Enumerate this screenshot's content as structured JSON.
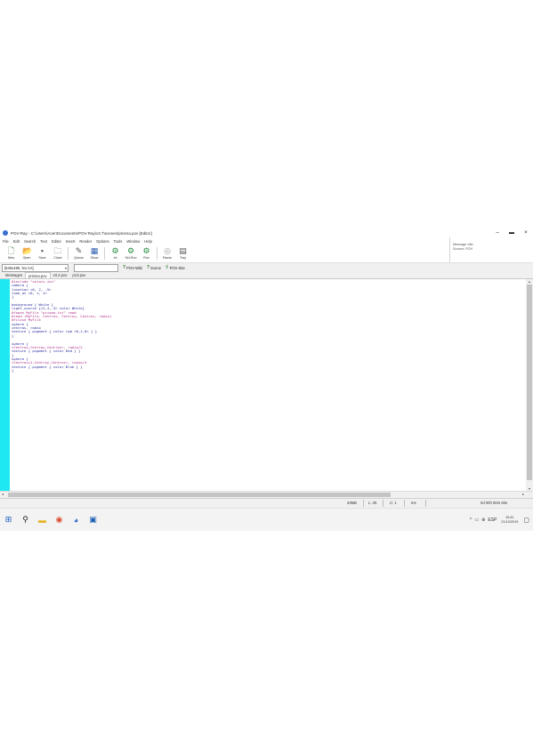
{
  "window": {
    "title": "POV-Ray - C:\\Users\\Acer\\Documents\\POV-Ray\\v3.7\\scenes\\prisma.pov [Editor]",
    "minimize": "–",
    "maximize": "▬",
    "close": "×"
  },
  "menu": [
    "File",
    "Edit",
    "Search",
    "Text",
    "Editor",
    "Insert",
    "Render",
    "Options",
    "Tools",
    "Window",
    "Help"
  ],
  "toolbar": [
    {
      "label": "New",
      "icon": "new-file-icon",
      "glyph": "🗋"
    },
    {
      "label": "Open",
      "icon": "open-folder-icon",
      "glyph": "📂"
    },
    {
      "label": "Save",
      "icon": "save-icon",
      "glyph": "▪"
    },
    {
      "label": "Close",
      "icon": "close-file-icon",
      "glyph": "🗀"
    },
    {
      "label": "Queue",
      "icon": "queue-icon",
      "glyph": "✎"
    },
    {
      "label": "Show",
      "icon": "show-icon",
      "glyph": "▦"
    },
    {
      "label": "Ini",
      "icon": "ini-icon",
      "glyph": "⚙"
    },
    {
      "label": "Sel-Run",
      "icon": "sel-run-icon",
      "glyph": "⚙"
    },
    {
      "label": "Run",
      "icon": "run-icon",
      "glyph": "⚙"
    },
    {
      "label": "Pause",
      "icon": "pause-icon",
      "glyph": "◎"
    },
    {
      "label": "Tray",
      "icon": "tray-icon",
      "glyph": "▤"
    }
  ],
  "message_panel": {
    "line1": "Message Idle",
    "line2": "Source: POV"
  },
  "resolution": {
    "value": "[640x480, No AA]",
    "arrow": "▾"
  },
  "links": [
    {
      "label": "POV-Wiki",
      "icon": "help-icon",
      "glyph": "?"
    },
    {
      "label": "Scene",
      "icon": "help-icon",
      "glyph": "?"
    },
    {
      "label": "POV-Site",
      "icon": "globe-icon",
      "glyph": "⚲"
    }
  ],
  "tabs": [
    {
      "label": "Messages",
      "active": false
    },
    {
      "label": "prisma.pov",
      "active": true
    },
    {
      "label": "v3.2.pov",
      "active": false
    },
    {
      "label": "p13.pov",
      "active": false
    }
  ],
  "code": [
    {
      "text": "#include \"colors.inc\"",
      "color": "#b0308a"
    },
    {
      "text": "camera {",
      "color": "#2a2aa0"
    },
    {
      "text": "location <0, 2, -5>",
      "color": "#2a2aa0"
    },
    {
      "text": "look_at <0, 1, 2>",
      "color": "#2a2aa0"
    },
    {
      "text": "}",
      "color": "#2a2aa0"
    },
    {
      "text": "",
      "color": "#2a2aa0"
    },
    {
      "text": "background { White }",
      "color": "#2a2aa0"
    },
    {
      "text": "light_source {<2,4,-3> color White}",
      "color": "#2a2aa0"
    },
    {
      "text": "#fopen MyFile \"prisma.txt\" read",
      "color": "#b0308a"
    },
    {
      "text": "#read (MyFile, Centrox, Centroy, Centroz, radio)",
      "color": "#b0308a"
    },
    {
      "text": "#fclose MyFile",
      "color": "#b0308a"
    },
    {
      "text": "sphere {",
      "color": "#2a2aa0"
    },
    {
      "text": "centros, radio",
      "color": "#2a2aa0"
    },
    {
      "text": "texture { pigment { color rgb <0,1,0> } }",
      "color": "#2a2aa0"
    },
    {
      "text": "}",
      "color": "#2a2aa0"
    },
    {
      "text": "",
      "color": "#2a2aa0"
    },
    {
      "text": "sphere {",
      "color": "#2a2aa0"
    },
    {
      "text": "<Centrox,Centroy,Centroz>, radio/2",
      "color": "#b0308a"
    },
    {
      "text": "texture { pigment { color Red } }",
      "color": "#2a2aa0"
    },
    {
      "text": "}",
      "color": "#2a2aa0"
    },
    {
      "text": "sphere {",
      "color": "#2a2aa0"
    },
    {
      "text": "<Centrox+2,Centroy,Centroz>, radio/4",
      "color": "#b0308a"
    },
    {
      "text": "texture { pigment { color Blue } }",
      "color": "#2a2aa0"
    },
    {
      "text": "}",
      "color": "#2a2aa0"
    }
  ],
  "status": {
    "mem": "33MB",
    "ins": "Ins",
    "line": "L: 25",
    "col": "C: 1",
    "time": "0d 00h 00m 00s"
  },
  "taskbar": {
    "icons": [
      {
        "name": "start-icon",
        "glyph": "⊞",
        "color": "#1b5fbf"
      },
      {
        "name": "search-icon",
        "glyph": "⚲",
        "color": "#222222"
      },
      {
        "name": "file-explorer-icon",
        "glyph": "▬",
        "color": "#e6b52a"
      },
      {
        "name": "chrome-icon",
        "glyph": "◉",
        "color": "#d94a2e"
      },
      {
        "name": "povray-icon",
        "glyph": "◕",
        "color": "#2a62c8"
      },
      {
        "name": "word-icon",
        "glyph": "▣",
        "color": "#1f5fb3"
      }
    ],
    "tray": [
      "^",
      "▭",
      "⊕",
      "ESP"
    ],
    "clock_time": "15:41",
    "clock_date": "21/10/2019"
  }
}
